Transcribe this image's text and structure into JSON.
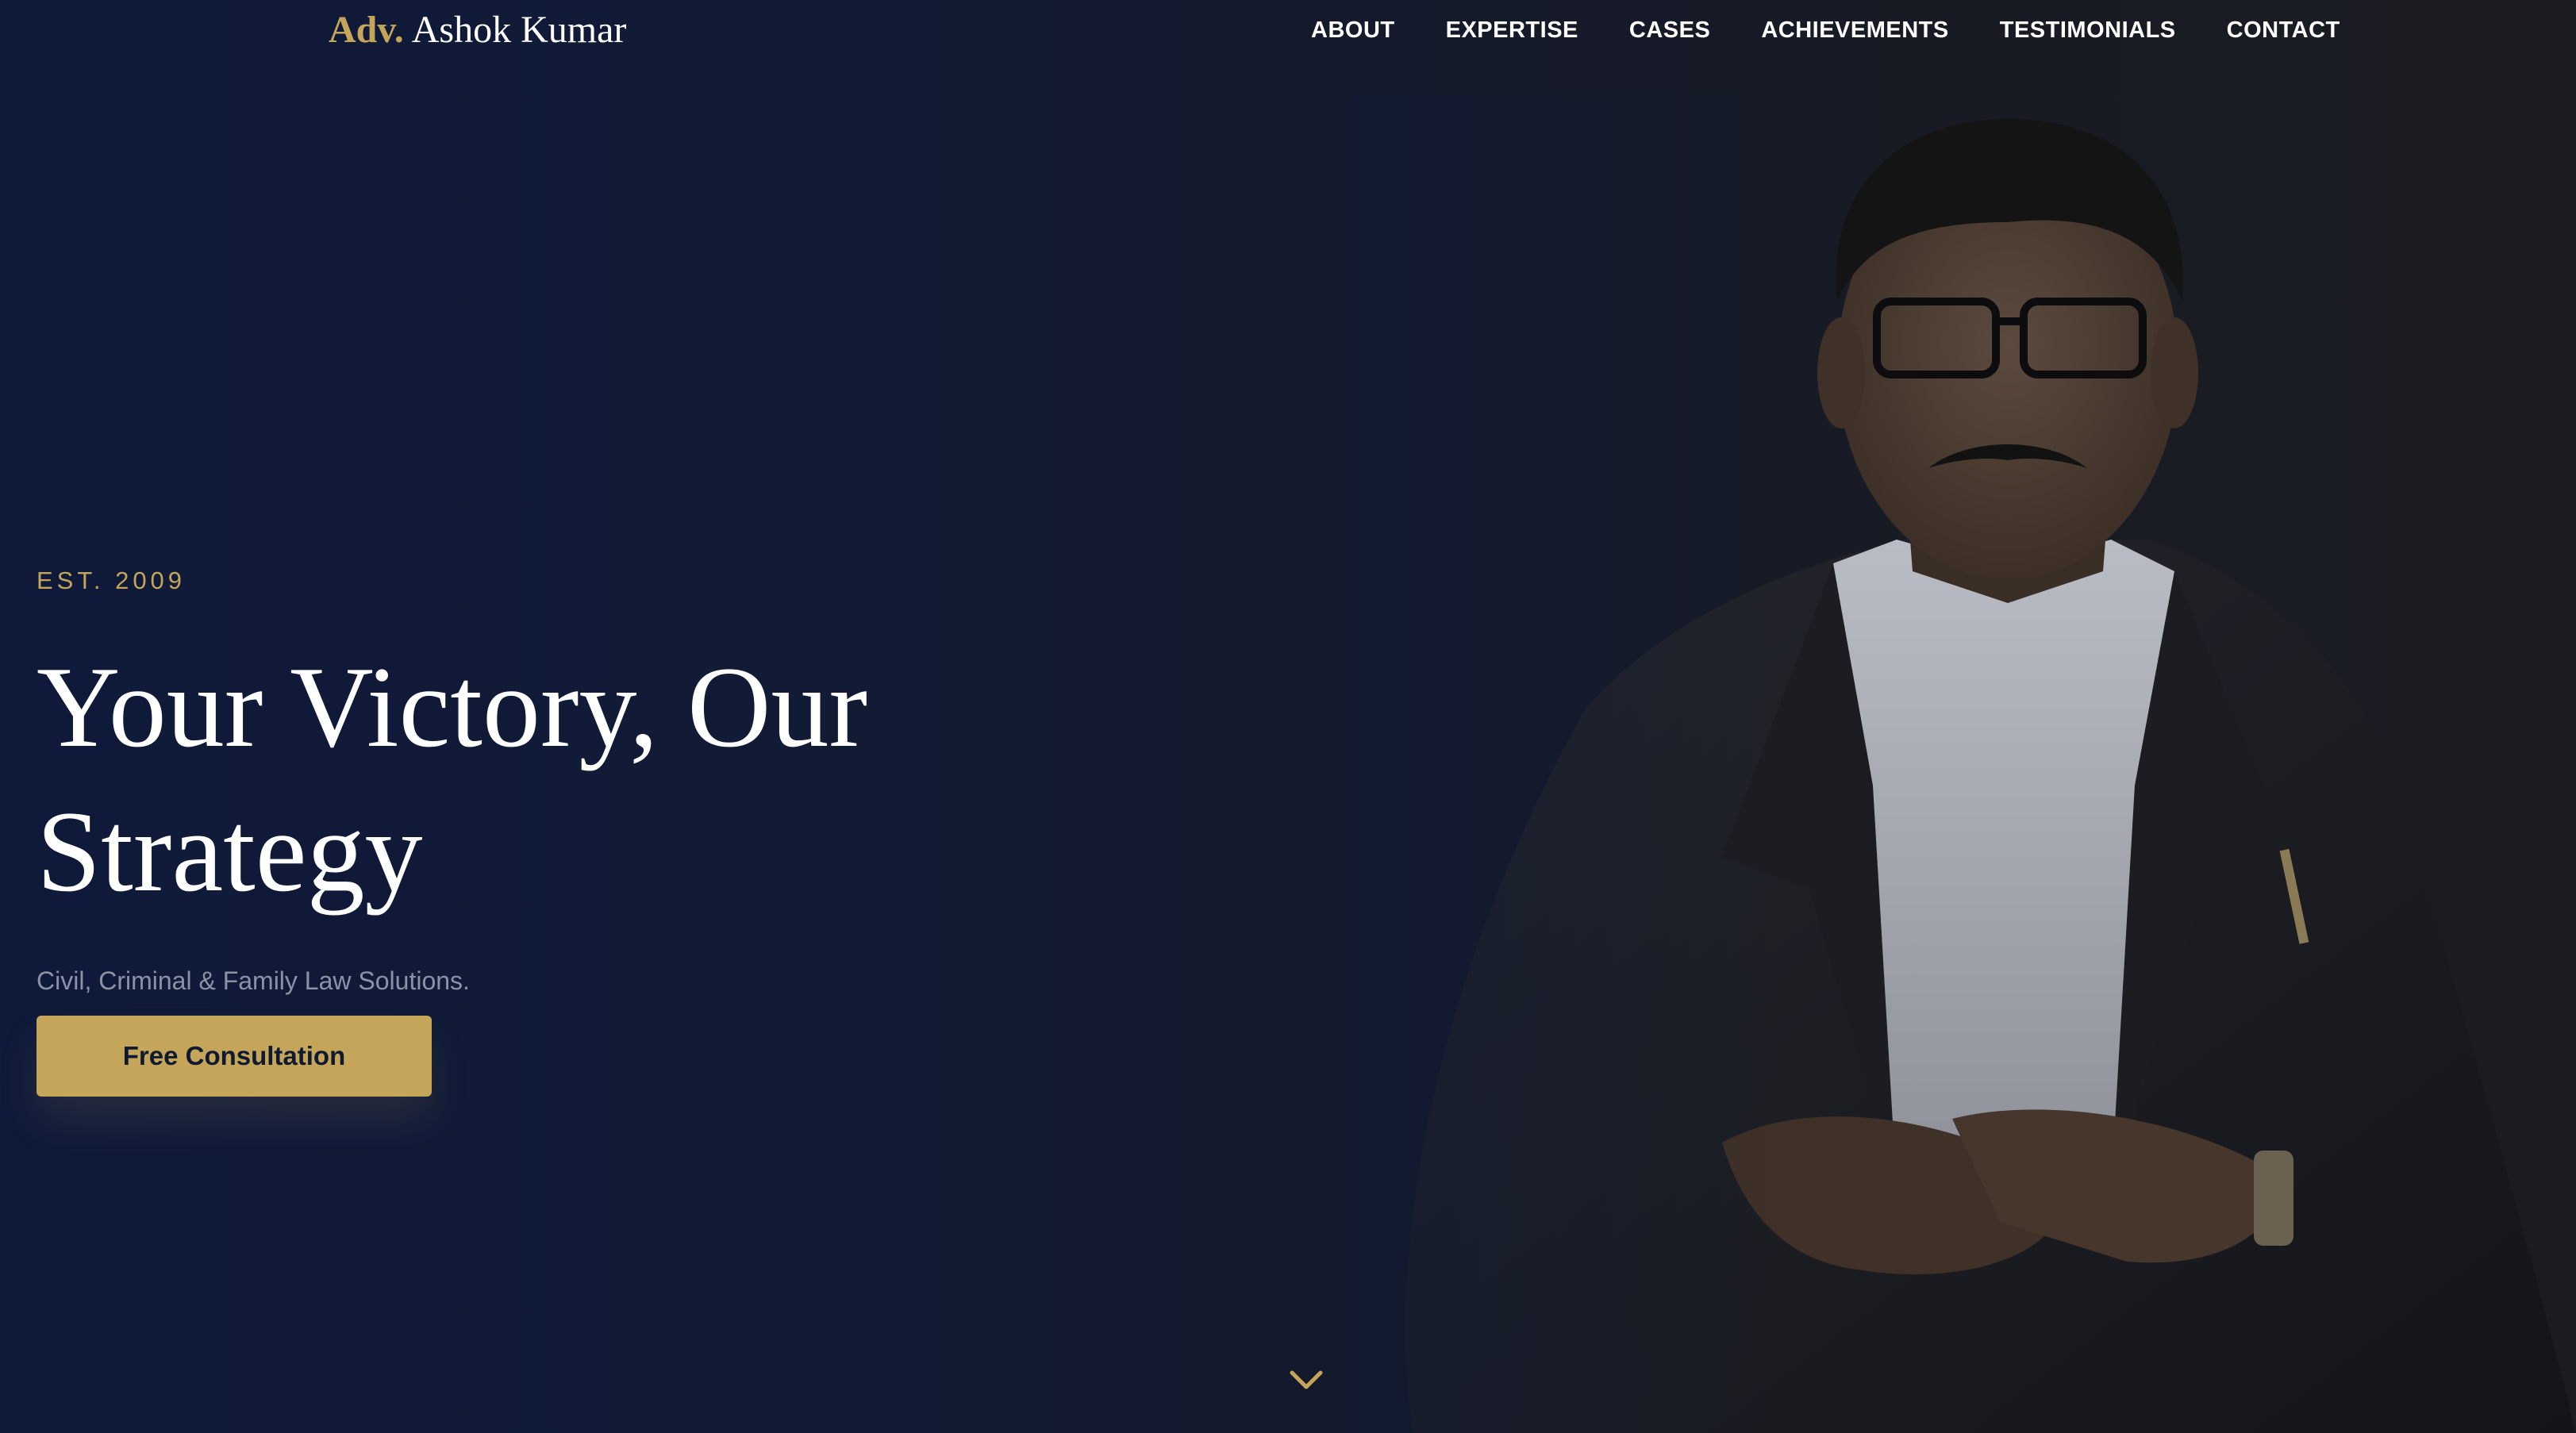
{
  "header": {
    "brand_prefix": "Adv.",
    "brand_name": "Ashok Kumar",
    "nav": [
      {
        "label": "ABOUT"
      },
      {
        "label": "EXPERTISE"
      },
      {
        "label": "CASES"
      },
      {
        "label": "ACHIEVEMENTS"
      },
      {
        "label": "TESTIMONIALS"
      },
      {
        "label": "CONTACT"
      }
    ]
  },
  "hero": {
    "eyebrow": "EST. 2009",
    "headline": "Your Victory, Our Strategy",
    "subheadline": "Civil, Criminal & Family Law Solutions.",
    "cta_label": "Free Consultation",
    "scroll_icon": "chevron-down-icon"
  },
  "colors": {
    "accent_gold": "#c4a55a",
    "background_navy": "#111a30",
    "text_white": "#ffffff",
    "text_muted": "#8a93a6"
  }
}
